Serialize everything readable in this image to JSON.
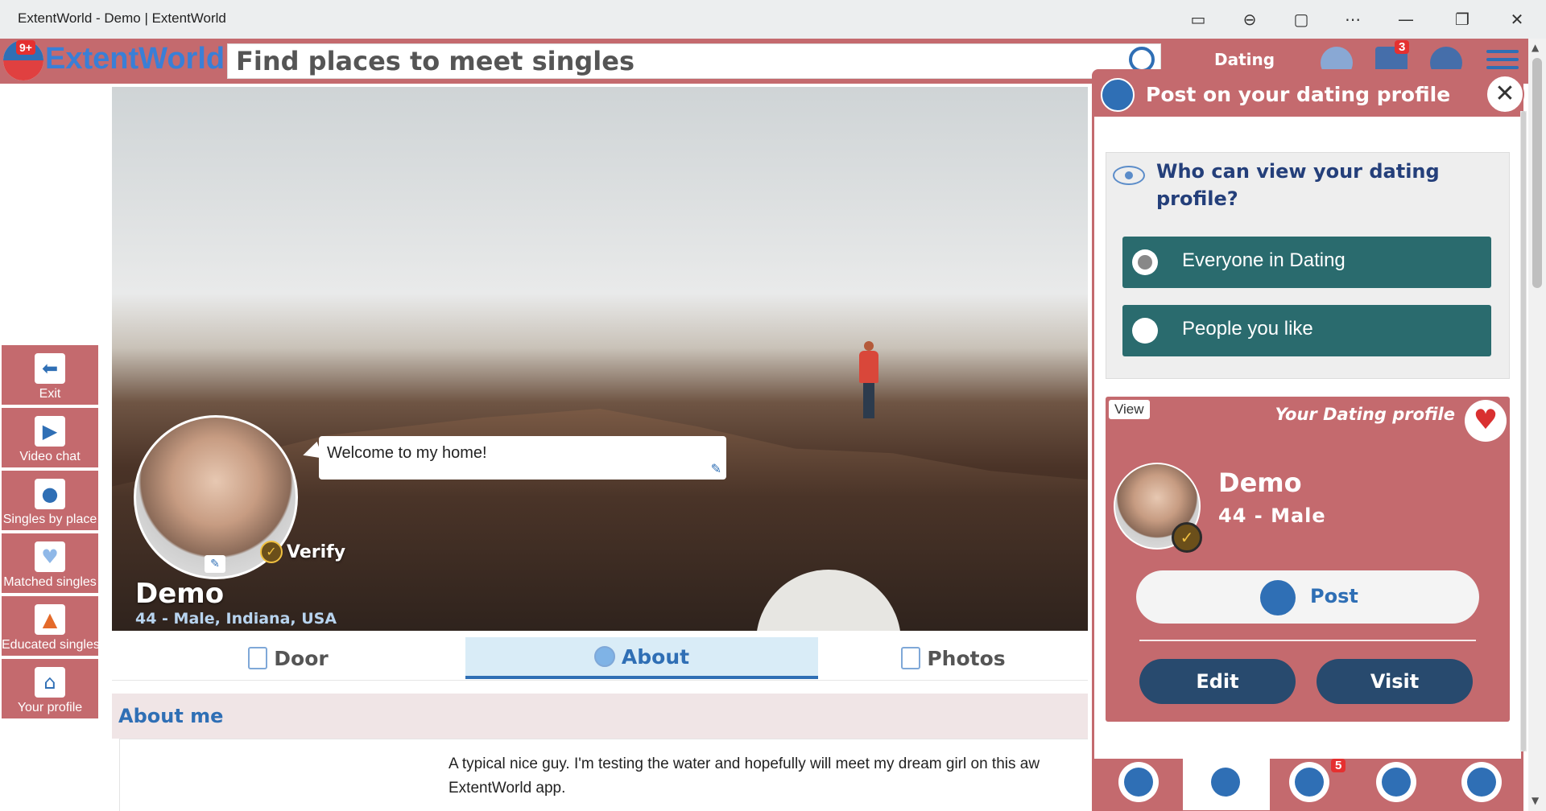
{
  "browser": {
    "title": "ExtentWorld - Demo | ExtentWorld",
    "controls": [
      "video-icon",
      "zoom-out-icon",
      "read-aloud-icon",
      "more-icon",
      "minimize-icon",
      "restore-icon",
      "close-icon"
    ]
  },
  "header": {
    "logo_count": "9+",
    "logo_text": "ExtentWorld",
    "search_placeholder": "Find places to meet singles",
    "nav_label": "Dating",
    "mail_badge": "3",
    "brand_color": "#c46a6e",
    "accent_color": "#2f6fb5"
  },
  "sidebar": {
    "items": [
      {
        "label": "Exit",
        "icon": "arrow-left-icon"
      },
      {
        "label": "Video chat",
        "icon": "video-chat-icon"
      },
      {
        "label": "Singles by place",
        "icon": "location-pin-icon"
      },
      {
        "label": "Matched singles",
        "icon": "hearts-icon"
      },
      {
        "label": "Educated singles",
        "icon": "graduation-cap-icon"
      },
      {
        "label": "Your profile",
        "icon": "home-icon"
      }
    ]
  },
  "profile": {
    "welcome": "Welcome to my home!",
    "verify": "Verify",
    "name": "Demo",
    "subtitle": "44 - Male, Indiana, USA"
  },
  "tabs": [
    {
      "label": "Door"
    },
    {
      "label": "About",
      "active": true
    },
    {
      "label": "Photos"
    }
  ],
  "about": {
    "heading": "About me",
    "text": "A typical nice guy. I'm testing the water and hopefully will meet my dream girl on this aw ExtentWorld app."
  },
  "panel": {
    "title": "Post on your dating profile",
    "question": "Who can view your dating profile?",
    "options": [
      {
        "label": "Everyone in Dating",
        "selected": true
      },
      {
        "label": "People you like",
        "selected": false
      }
    ],
    "card": {
      "view_label": "View",
      "title": "Your Dating profile",
      "name": "Demo",
      "subtitle": "44 - Male",
      "post_label": "Post",
      "edit_label": "Edit",
      "visit_label": "Visit"
    },
    "bottom": {
      "chat_badge": "5"
    }
  }
}
